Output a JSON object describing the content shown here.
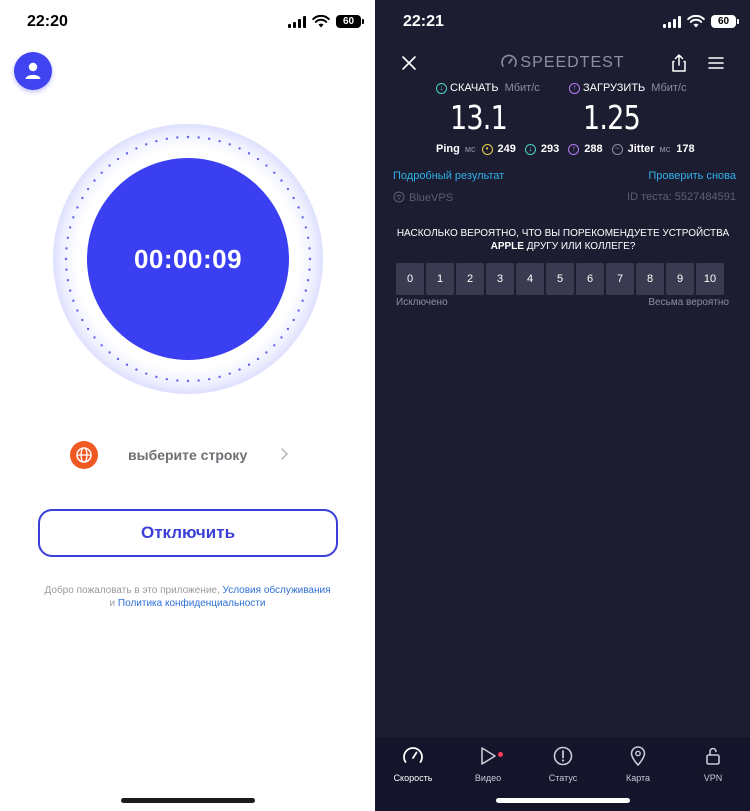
{
  "left": {
    "status_bar": {
      "time": "22:20",
      "battery": "60"
    },
    "timer": "00:00:09",
    "server": {
      "label": "выберите строку"
    },
    "disconnect_label": "Отключить",
    "terms": {
      "prefix": "Добро пожаловать в это приложение, ",
      "tos": "Условия обслуживания",
      "and": "и ",
      "privacy": "Политика конфиденциальности"
    },
    "colors": {
      "accent": "#3b3ff2",
      "globe": "#f05a22",
      "link": "#2d6fd6"
    },
    "icons": [
      "user-icon",
      "globe-icon",
      "chevron-right-icon"
    ]
  },
  "right": {
    "status_bar": {
      "time": "22:21",
      "battery": "60"
    },
    "brand": "SPEEDTEST",
    "download": {
      "label": "СКАЧАТЬ",
      "unit": "Мбит/с",
      "value": "13.1"
    },
    "upload": {
      "label": "ЗАГРУЗИТЬ",
      "unit": "Мбит/с",
      "value": "1.25"
    },
    "ping": {
      "label": "Ping",
      "unit": "мс",
      "idle": "249",
      "down": "293",
      "up": "288",
      "jitter_label": "Jitter",
      "jitter_unit": "мс",
      "jitter": "178"
    },
    "details_link": "Подробный результат",
    "retest_link": "Проверить снова",
    "host": "BlueVPS",
    "test_id": "ID теста: 5527484591",
    "question": {
      "line1": "НАСКОЛЬКО ВЕРОЯТНО, ЧТО ВЫ ПОРЕКОМЕНДУЕТЕ УСТРОЙСТВА",
      "brand": "APPLE",
      "line2": " ДРУГУ ИЛИ КОЛЛЕГЕ?"
    },
    "scale": [
      "0",
      "1",
      "2",
      "3",
      "4",
      "5",
      "6",
      "7",
      "8",
      "9",
      "10"
    ],
    "scale_min_label": "Исключено",
    "scale_max_label": "Весьма вероятно",
    "tabs": [
      {
        "label": "Скорость",
        "icon": "speedometer-icon"
      },
      {
        "label": "Видео",
        "icon": "play-icon"
      },
      {
        "label": "Статус",
        "icon": "alert-icon"
      },
      {
        "label": "Карта",
        "icon": "map-pin-icon"
      },
      {
        "label": "VPN",
        "icon": "lock-icon"
      }
    ],
    "colors": {
      "download": "#49d3c3",
      "upload": "#b57cf3",
      "link": "#2fb1e6",
      "background": "#1d1d32"
    }
  }
}
